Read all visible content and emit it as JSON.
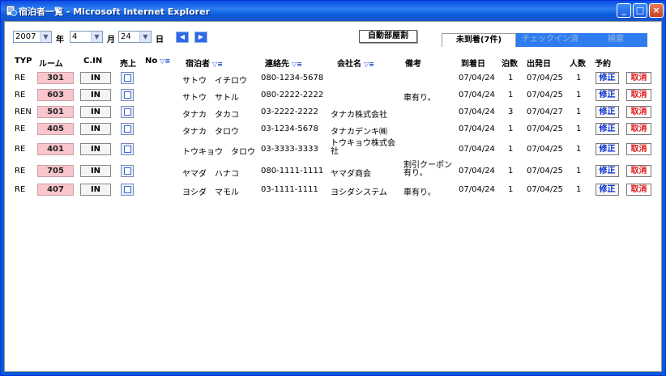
{
  "window": {
    "title": "宿泊者一覧 - Microsoft Internet Explorer"
  },
  "controls": {
    "year": "2007",
    "year_label": "年",
    "month": "4",
    "month_label": "月",
    "day": "24",
    "day_label": "日",
    "prev_icon": "◀",
    "next_icon": "▶",
    "auto_assign": "自動部屋割"
  },
  "tabs": [
    {
      "label": "未到着(7件)"
    },
    {
      "label": "チェックイン済"
    },
    {
      "label": "検索"
    }
  ],
  "columns": {
    "typ": "TYP",
    "room": "ルーム",
    "cin": "C.IN",
    "sales": "売上",
    "no": "No",
    "guest": "宿泊者",
    "contact": "連絡先",
    "company": "会社名",
    "remarks": "備考",
    "arrival": "到着日",
    "nights": "泊数",
    "departure": "出発日",
    "people": "人数",
    "reservation": "予約"
  },
  "sort_icon": "▽≡",
  "rows": [
    {
      "typ": "RE",
      "room": "301",
      "cin": "IN",
      "guest": "サトウ　イチロウ",
      "contact": "080-1234-5678",
      "company": "",
      "remarks": "",
      "arrival": "07/04/24",
      "nights": "1",
      "departure": "07/04/25",
      "people": "1",
      "edit": "修正",
      "cancel": "取消"
    },
    {
      "typ": "RE",
      "room": "603",
      "cin": "IN",
      "guest": "サトウ　サトル",
      "contact": "080-2222-2222",
      "company": "",
      "remarks": "車有り。",
      "arrival": "07/04/24",
      "nights": "1",
      "departure": "07/04/25",
      "people": "1",
      "edit": "修正",
      "cancel": "取消"
    },
    {
      "typ": "REN",
      "room": "501",
      "cin": "IN",
      "guest": "タナカ　タカコ",
      "contact": "03-2222-2222",
      "company": "タナカ株式会社",
      "remarks": "",
      "arrival": "07/04/24",
      "nights": "3",
      "departure": "07/04/27",
      "people": "1",
      "edit": "修正",
      "cancel": "取消"
    },
    {
      "typ": "RE",
      "room": "405",
      "cin": "IN",
      "guest": "タナカ　タロウ",
      "contact": "03-1234-5678",
      "company": "タナカデンキ㈱",
      "remarks": "",
      "arrival": "07/04/24",
      "nights": "1",
      "departure": "07/04/25",
      "people": "1",
      "edit": "修正",
      "cancel": "取消"
    },
    {
      "typ": "RE",
      "room": "401",
      "cin": "IN",
      "guest": "トウキョウ　タロウ",
      "contact": "03-3333-3333",
      "company": "トウキョウ株式会社",
      "remarks": "",
      "arrival": "07/04/24",
      "nights": "1",
      "departure": "07/04/25",
      "people": "1",
      "edit": "修正",
      "cancel": "取消"
    },
    {
      "typ": "RE",
      "room": "705",
      "cin": "IN",
      "guest": "ヤマダ　ハナコ",
      "contact": "080-1111-1111",
      "company": "ヤマダ商会",
      "remarks": "割引クーポン有り。",
      "arrival": "07/04/24",
      "nights": "1",
      "departure": "07/04/25",
      "people": "1",
      "edit": "修正",
      "cancel": "取消"
    },
    {
      "typ": "RE",
      "room": "407",
      "cin": "IN",
      "guest": "ヨシダ　マモル",
      "contact": "03-1111-1111",
      "company": "ヨシダシステム",
      "remarks": "車有り。",
      "arrival": "07/04/24",
      "nights": "1",
      "departure": "07/04/25",
      "people": "1",
      "edit": "修正",
      "cancel": "取消"
    }
  ]
}
